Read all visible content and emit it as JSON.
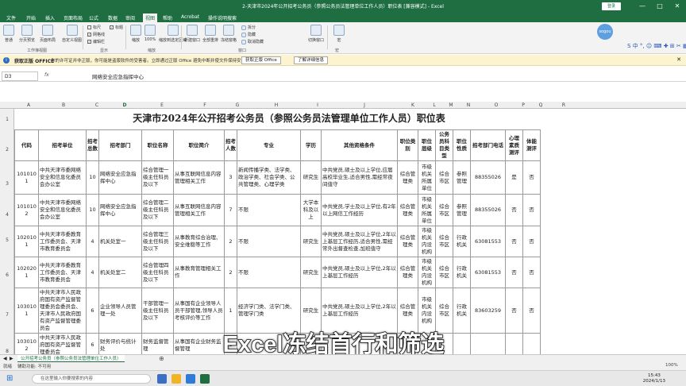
{
  "window": {
    "title": "2-天津市2024年公开招考公务员（参照公务员法管理单位工作人员）职位表 [兼容模式] - Excel",
    "login": "登录",
    "min": "—",
    "max": "□",
    "close": "✕"
  },
  "ribbon_tabs": [
    "文件",
    "开始",
    "插入",
    "页面布局",
    "公式",
    "数据",
    "审阅",
    "视图",
    "帮助",
    "Acrobat",
    "操作说明搜索"
  ],
  "active_tab_index": 7,
  "ribbon": {
    "btn_normal": "普通",
    "btn_pagebreak": "分页预览",
    "btn_pagelayout": "页面布局",
    "btn_custom": "自定义视图",
    "group_workbook_views": "工作簿视图",
    "chk_ruler": "标尺",
    "chk_gridlines": "网格线",
    "chk_formula": "编辑栏",
    "chk_headings": "标题",
    "group_show": "显示",
    "btn_zoom": "缩放",
    "btn_100": "100%",
    "btn_zoom_sel": "缩放到选定区域",
    "group_zoom": "缩放",
    "btn_newwin": "新建窗口",
    "btn_arrange": "全部重排",
    "btn_freeze": "冻结窗格",
    "btn_split": "拆分",
    "btn_hide": "隐藏",
    "btn_unhide": "取消隐藏",
    "group_window": "窗口",
    "btn_switch": "切换窗口",
    "btn_macro": "宏",
    "group_macro": "宏"
  },
  "sogou": "sogou",
  "ime_bar": "S 中 °, ☺ ⌨ ✚ ⊞ ✂ ▦",
  "infobar": {
    "brand": "获取正版 OFFICE",
    "message": "你的许可证并非正版，你可能是盗版软件的受害者。立即通过正版 Office 避免中断并使文件保持安全。",
    "btn_get": "获取正版 Office",
    "btn_more": "了解详细信息"
  },
  "formula_bar": {
    "name_box": "D3",
    "fx": "fx",
    "content": "网络安全应急指挥中心"
  },
  "columns": [
    "A",
    "B",
    "C",
    "D",
    "E",
    "F",
    "G",
    "H",
    "I",
    "J",
    "K",
    "L",
    "M",
    "N",
    "O",
    "P",
    "Q",
    "R"
  ],
  "rows": [
    "1",
    "2",
    "3",
    "4",
    "5",
    "6",
    "7",
    "8"
  ],
  "sheet": {
    "title": "天津市2024年公开招考公务员（参照公务员法管理单位工作人员）职位表",
    "headers": [
      "代码",
      "招考单位",
      "招考总数",
      "招考部门",
      "职位名称",
      "职位简介",
      "招考人数",
      "专业",
      "学历",
      "其他资格条件",
      "职位类别",
      "职位层级",
      "公务员科目类型",
      "职位性质",
      "招考部门电话",
      "心理素质测评",
      "体能测评"
    ],
    "rows": [
      [
        "1010101",
        "中共天津市委网络安全和信息化委员会办公室",
        "10",
        "网络安全应急指挥中心",
        "综合管理一级主任科员及以下",
        "从事互联网信息内容管理相关工作",
        "3",
        "新闻传播学类、法学类、政治学类、社会学类、公共管理类、心理学类",
        "研究生",
        "中共党员,硕士及以上学位,应届高校毕业生,适合男性,需经常夜间值守",
        "综合管理类",
        "市级机关所属单位",
        "综合市区",
        "参照管理",
        "88355026",
        "是",
        "否"
      ],
      [
        "1010102",
        "中共天津市委网络安全和信息化委员会办公室",
        "10",
        "网络安全应急指挥中心",
        "综合管理二级主任科员及以下",
        "从事互联网信息内容管理相关工作",
        "7",
        "不限",
        "大学本科及以上",
        "中共党员,学士及以上学位,有2年以上网信工作经历",
        "综合管理类",
        "市级机关所属单位",
        "综合市区",
        "参照管理",
        "88355026",
        "否",
        "否"
      ],
      [
        "1020101",
        "中共天津市委教育工作委员会、天津市教育委员会",
        "4",
        "机关处室一",
        "综合管理三级主任科员及以下",
        "从事教育综合治理、安全维稳等工作",
        "2",
        "不限",
        "研究生",
        "中共党员,硕士及以上学位,2年以上基层工作经历,适合男性,需经常外出督查检查,加班值守",
        "综合管理类",
        "市级机关内设机构",
        "综合市区",
        "行政机关",
        "63081553",
        "否",
        "否"
      ],
      [
        "1020201",
        "中共天津市委教育工作委员会、天津市教育委员会",
        "4",
        "机关处室二",
        "综合管理四级主任科员及以下",
        "从事教育管理相关工作",
        "2",
        "不限",
        "研究生",
        "中共党员,硕士及以上学位,2年以上基层工作经历",
        "综合管理类",
        "市级机关内设机构",
        "综合市区",
        "行政机关",
        "63081553",
        "否",
        "否"
      ],
      [
        "1030101",
        "中共天津市人民政府国有资产监督管理委员会委员会、天津市人民政府国有资产监督管理委员会",
        "6",
        "企业领导人员管理一处",
        "干部管理一级主任科员及以下",
        "从事国有企业领导人员干部管理,领导人员考核评价等工作",
        "1",
        "经济学门类、法学门类、管理学门类",
        "研究生",
        "中共党员,硕士及以上学位,2年以上基层工作经历",
        "综合管理类",
        "市级机关内设机构",
        "综合市区",
        "行政机关",
        "83603259",
        "否",
        "否"
      ],
      [
        "1030102",
        "中共天津市人民政府国有资产监督管理委员会",
        "6",
        "财务评价与统计处",
        "财务监督管理",
        "从事国有企业财务监督管理",
        "1",
        "",
        "",
        "",
        "",
        "",
        "",
        "",
        "",
        "",
        ""
      ]
    ]
  },
  "caption": "Excel冻结首行和筛选",
  "sheet_tab": "公开招考公务员（参照公务员法管理单位工作人员）",
  "status": {
    "ready": "就绪",
    "accessibility": "辅助功能: 不可用",
    "zoom": "100%"
  },
  "taskbar": {
    "search_placeholder": "在这里输入你要搜索的内容",
    "time": "15:43",
    "date": "2024/1/13"
  }
}
